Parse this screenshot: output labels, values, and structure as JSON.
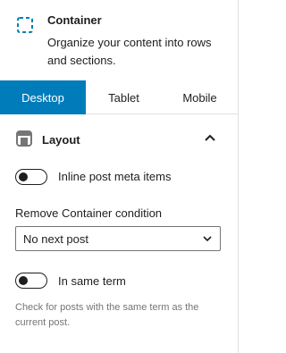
{
  "block": {
    "icon": "container-dashed-square-icon",
    "title": "Container",
    "description": "Organize your content into rows and sections."
  },
  "tabs": [
    {
      "label": "Desktop",
      "active": true
    },
    {
      "label": "Tablet",
      "active": false
    },
    {
      "label": "Mobile",
      "active": false
    }
  ],
  "layout_panel": {
    "icon": "layout-icon",
    "title": "Layout",
    "expanded": true,
    "toggle_icon": "chevron-up-icon",
    "inline_toggle": {
      "label": "Inline post meta items",
      "checked": false
    },
    "remove_condition": {
      "label": "Remove Container condition",
      "value": "No next post"
    },
    "same_term_toggle": {
      "label": "In same term",
      "checked": false
    },
    "help_text": "Check for posts with the same term as the current post."
  },
  "colors": {
    "accent": "#007cba",
    "text": "#1e1e1e",
    "muted": "#757575",
    "border": "#e0e0e0"
  }
}
